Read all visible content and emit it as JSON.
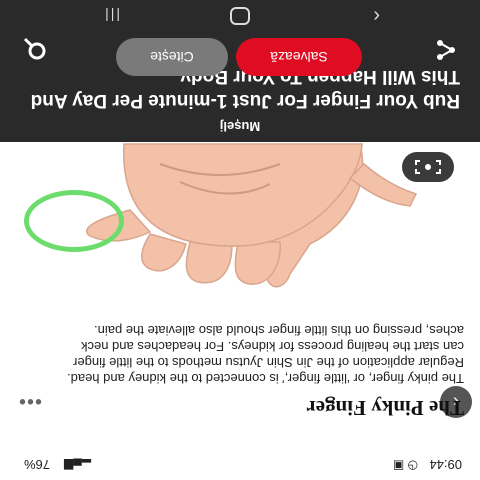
{
  "status_bar": {
    "time": "09:44",
    "battery": "76%"
  },
  "header": {
    "source": "Mușelj",
    "headline": "Rub Your Finger For Just 1-minute Per Day And This Will Happen To Your Body",
    "save_label": "Salvează",
    "read_label": "Citește"
  },
  "article": {
    "title": "The Pinky Finger",
    "body": "The pinky finger, or ‘little finger,’ is connected to the kidney and head. Regular application of the Jin Shin Jyutsu methods to the little finger can start the healing process for kidneys. For headaches and neck aches, pressing on this little finger should also alleviate the pain.",
    "more_label": "•••"
  },
  "icons": {
    "back": "back-arrow-icon",
    "share": "share-icon",
    "search": "search-icon",
    "scan": "lens-scan-icon"
  },
  "colors": {
    "save": "#e00d22",
    "read": "#7a7a7a",
    "header_bg": "#2a2a2a",
    "highlight_ring": "#6cdc6c"
  }
}
